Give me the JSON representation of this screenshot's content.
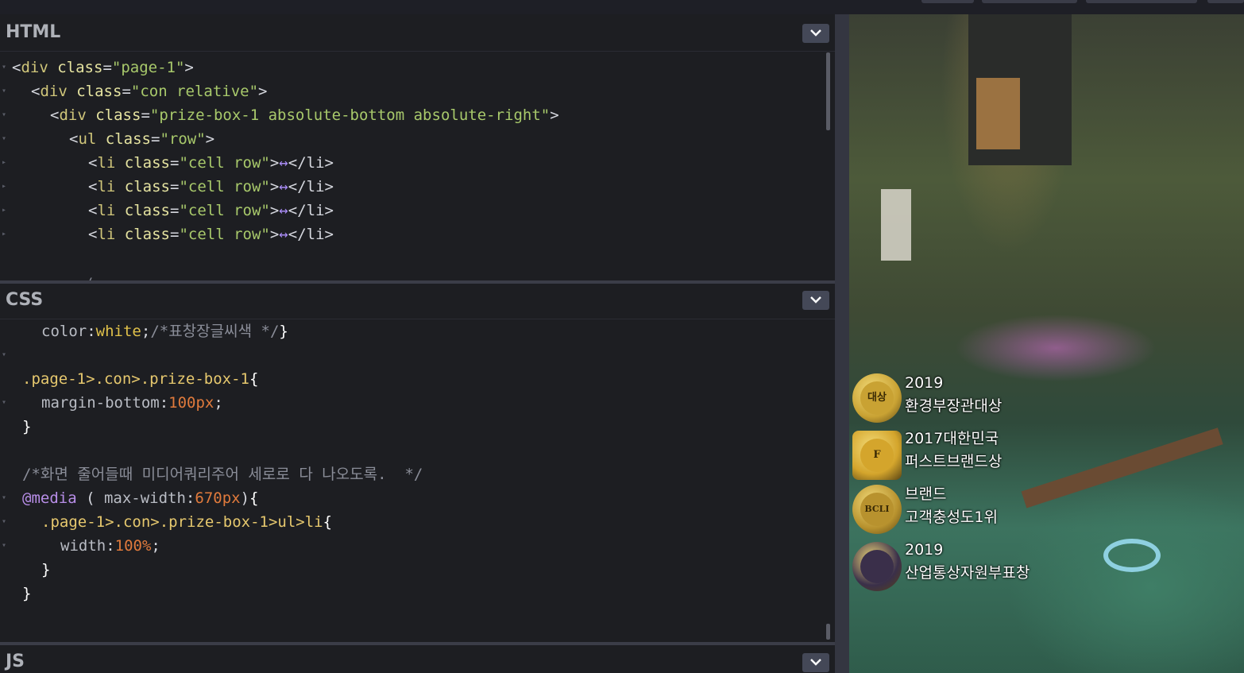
{
  "panels": {
    "html": {
      "title": "HTML",
      "lines": [
        {
          "indent": "",
          "tag": "div",
          "attr": "class",
          "value": "\"page-1\"",
          "suffix": ">"
        },
        {
          "indent": "  ",
          "tag": "div",
          "attr": "class",
          "value": "\"con relative\"",
          "suffix": ">"
        },
        {
          "indent": "    ",
          "tag": "div",
          "attr": "class",
          "value": "\"prize-box-1 absolute-bottom absolute-right\"",
          "suffix": ">"
        },
        {
          "indent": "      ",
          "tag": "ul",
          "attr": "class",
          "value": "\"row\"",
          "suffix": ">"
        },
        {
          "indent": "        ",
          "tag": "li",
          "attr": "class",
          "value": "\"cell row\"",
          "suffix": ">",
          "ellipsis": "↔",
          "close": "</li>"
        },
        {
          "indent": "        ",
          "tag": "li",
          "attr": "class",
          "value": "\"cell row\"",
          "suffix": ">",
          "ellipsis": "↔",
          "close": "</li>"
        },
        {
          "indent": "        ",
          "tag": "li",
          "attr": "class",
          "value": "\"cell row\"",
          "suffix": ">",
          "ellipsis": "↔",
          "close": "</li>"
        },
        {
          "indent": "        ",
          "tag": "li",
          "attr": "class",
          "value": "\"cell row\"",
          "suffix": ">",
          "ellipsis": "↔",
          "close": "</li>"
        }
      ]
    },
    "css": {
      "title": "CSS",
      "line_color_prop": "color",
      "line_color_value": "white",
      "line_color_comment": "/*표창장글씨색 */",
      "sel_1": ".page-1>.con>.prize-box-1",
      "prop_margin": "margin-bottom",
      "val_margin": "100px",
      "comment_media": "/*화면 줄어들때 미디어쿼리주어 세로로 다 나오도록.  */",
      "media_kw": "@media",
      "media_prop": "max-width",
      "media_val": "670px",
      "sel_2": ".page-1>.con>.prize-box-1>ul>li",
      "prop_width": "width",
      "val_width": "100%"
    },
    "js": {
      "title": "JS"
    }
  },
  "preview": {
    "prizes": [
      {
        "line1": "2019",
        "line2": "환경부장관대상",
        "medal_text": "대상",
        "medal_color": "#c9a233"
      },
      {
        "line1": "2017대한민국",
        "line2": "퍼스트브랜드상",
        "medal_text": "F",
        "medal_color": "#d4a52c"
      },
      {
        "line1": "브랜드",
        "line2": "고객충성도1위",
        "medal_text": "BCLI",
        "medal_color": "#b8922e"
      },
      {
        "line1": "2019",
        "line2": "산업통상자원부표창",
        "medal_text": "",
        "medal_color": "#3a2f4a"
      }
    ]
  }
}
